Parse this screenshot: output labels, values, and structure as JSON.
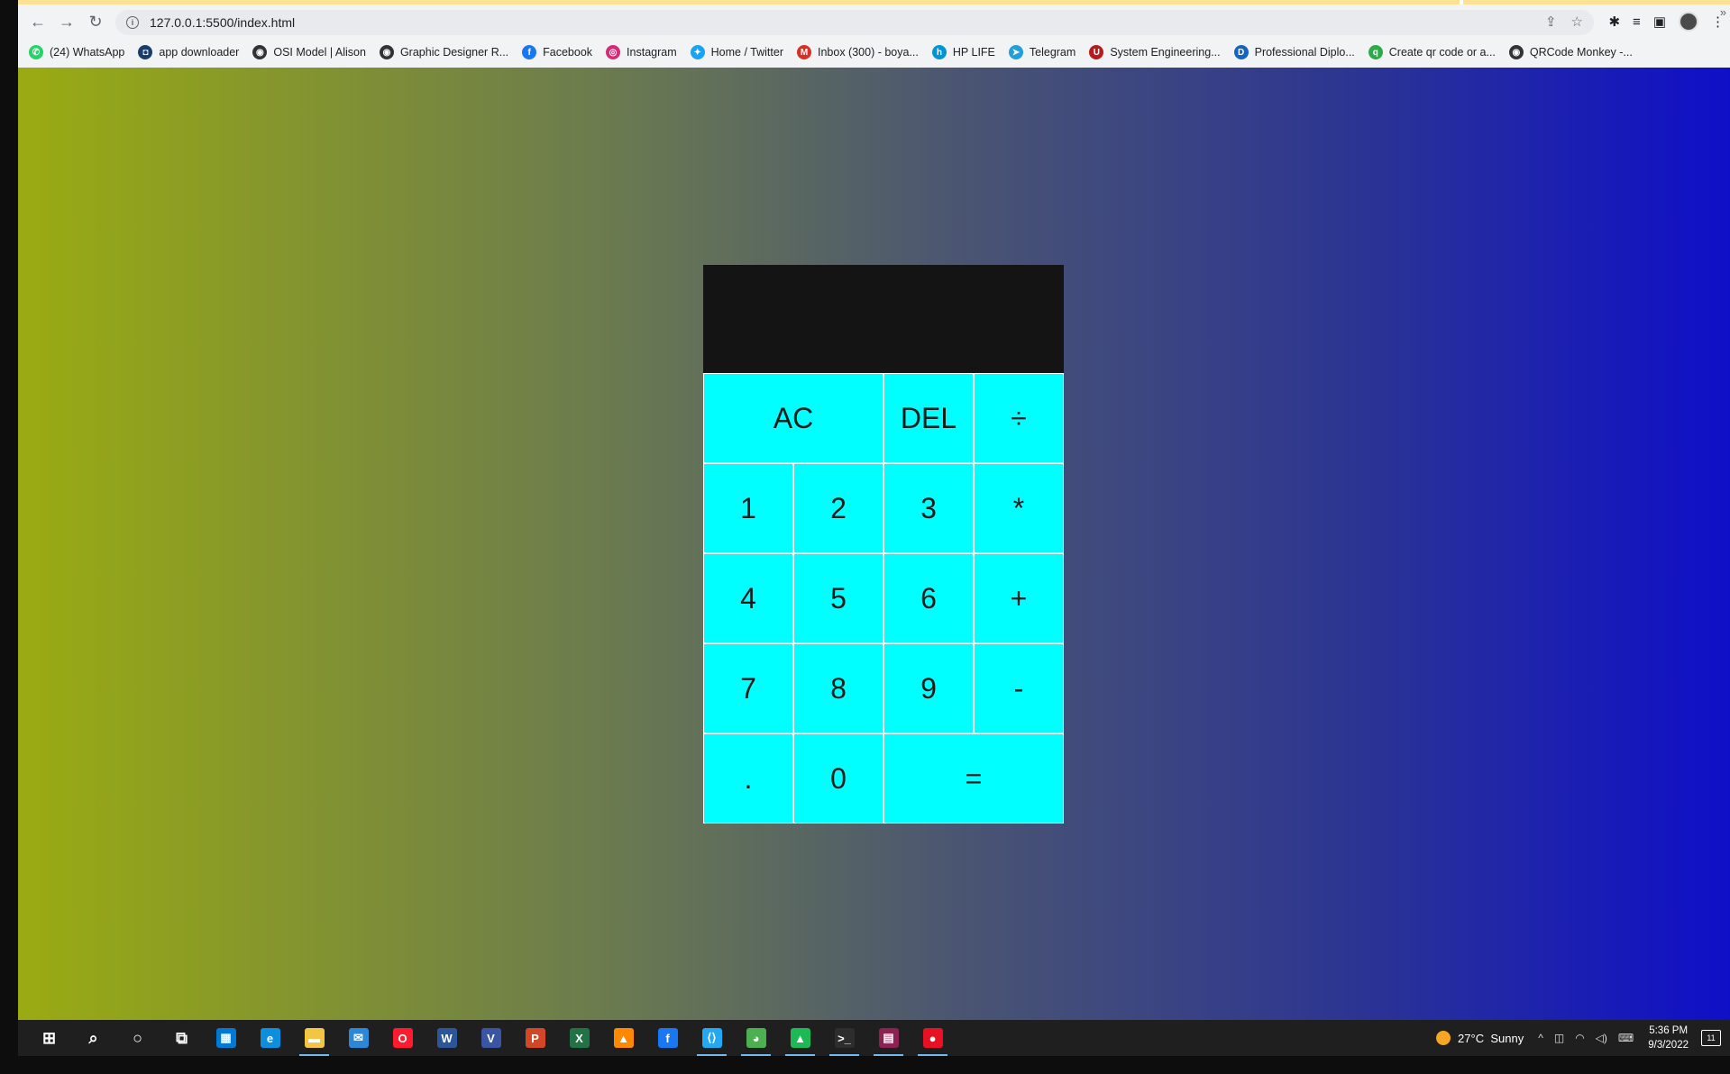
{
  "browser": {
    "url": "127.0.0.1:5500/index.html",
    "bookmarks": [
      {
        "label": "(24) WhatsApp",
        "icon": "whatsapp-icon",
        "color": "#25d366",
        "glyph": "✆"
      },
      {
        "label": "app downloader",
        "icon": "app-downloader-icon",
        "color": "#1a3d6d",
        "glyph": "◘"
      },
      {
        "label": "OSI Model | Alison",
        "icon": "globe-icon",
        "color": "#333333",
        "glyph": "◉"
      },
      {
        "label": "Graphic Designer R...",
        "icon": "globe-icon",
        "color": "#333333",
        "glyph": "◉"
      },
      {
        "label": "Facebook",
        "icon": "facebook-icon",
        "color": "#1877f2",
        "glyph": "f"
      },
      {
        "label": "Instagram",
        "icon": "instagram-icon",
        "color": "#d62976",
        "glyph": "◎"
      },
      {
        "label": "Home / Twitter",
        "icon": "twitter-icon",
        "color": "#1da1f2",
        "glyph": "✦"
      },
      {
        "label": "Inbox (300) - boya...",
        "icon": "gmail-icon",
        "color": "#d93025",
        "glyph": "M"
      },
      {
        "label": "HP LIFE",
        "icon": "hp-icon",
        "color": "#0096d6",
        "glyph": "h"
      },
      {
        "label": "Telegram",
        "icon": "telegram-icon",
        "color": "#229ed9",
        "glyph": "➤"
      },
      {
        "label": "System Engineering...",
        "icon": "university-icon",
        "color": "#b71c1c",
        "glyph": "U"
      },
      {
        "label": "Professional Diplo...",
        "icon": "document-icon",
        "color": "#1565c0",
        "glyph": "D"
      },
      {
        "label": "Create qr code or a...",
        "icon": "qr-generator-icon",
        "color": "#2eaa4a",
        "glyph": "q"
      },
      {
        "label": "QRCode Monkey -...",
        "icon": "globe-icon",
        "color": "#333333",
        "glyph": "◉"
      }
    ],
    "bookmarks_more": "»"
  },
  "calculator": {
    "previous_operand": "",
    "current_operand": "",
    "keys": {
      "ac": "AC",
      "del": "DEL",
      "divide": "÷",
      "one": "1",
      "two": "2",
      "three": "3",
      "multiply": "*",
      "four": "4",
      "five": "5",
      "six": "6",
      "add": "+",
      "seven": "7",
      "eight": "8",
      "nine": "9",
      "subtract": "-",
      "decimal": ".",
      "zero": "0",
      "equals": "="
    },
    "colors": {
      "display": "#141414",
      "key": "#00ffff"
    }
  },
  "taskbar": {
    "apps": [
      {
        "name": "start-button",
        "icon": "windows-icon",
        "color": "#ffffff",
        "glyph": "⊞"
      },
      {
        "name": "search-button",
        "icon": "search-icon",
        "color": "#ffffff",
        "glyph": "⌕"
      },
      {
        "name": "cortana-button",
        "icon": "cortana-icon",
        "color": "#ffffff",
        "glyph": "○"
      },
      {
        "name": "task-view-button",
        "icon": "task-view-icon",
        "color": "#ffffff",
        "glyph": "⧉"
      },
      {
        "name": "store-app",
        "icon": "store-icon",
        "color": "#0078d4",
        "glyph": "▦"
      },
      {
        "name": "edge-app",
        "icon": "edge-icon",
        "color": "#0c8fdc",
        "glyph": "e"
      },
      {
        "name": "file-explorer-app",
        "icon": "folder-icon",
        "color": "#f4c542",
        "glyph": "▬"
      },
      {
        "name": "mail-app",
        "icon": "mail-icon",
        "color": "#2b88d8",
        "glyph": "✉"
      },
      {
        "name": "opera-app",
        "icon": "opera-icon",
        "color": "#ff1b2d",
        "glyph": "O"
      },
      {
        "name": "word-app",
        "icon": "word-icon",
        "color": "#2b579a",
        "glyph": "W"
      },
      {
        "name": "visio-app",
        "icon": "visio-icon",
        "color": "#3955a3",
        "glyph": "V"
      },
      {
        "name": "powerpoint-app",
        "icon": "powerpoint-icon",
        "color": "#d24726",
        "glyph": "P"
      },
      {
        "name": "excel-app",
        "icon": "excel-icon",
        "color": "#217346",
        "glyph": "X"
      },
      {
        "name": "vlc-app",
        "icon": "vlc-icon",
        "color": "#ff8800",
        "glyph": "▲"
      },
      {
        "name": "facebook-app",
        "icon": "facebook-icon",
        "color": "#1877f2",
        "glyph": "f"
      },
      {
        "name": "vscode-app",
        "icon": "vscode-icon",
        "color": "#23a9f2",
        "glyph": "⟨⟩"
      },
      {
        "name": "chrome-app",
        "icon": "chrome-icon",
        "color": "#4caf50",
        "glyph": "◕"
      },
      {
        "name": "android-studio-app",
        "icon": "triangle-app-icon",
        "color": "#1db954",
        "glyph": "▲"
      },
      {
        "name": "terminal-app",
        "icon": "terminal-icon",
        "color": "#2d2d2d",
        "glyph": ">_"
      },
      {
        "name": "winrar-app",
        "icon": "winrar-icon",
        "color": "#8b2252",
        "glyph": "▤"
      },
      {
        "name": "recorder-app",
        "icon": "record-icon",
        "color": "#e81123",
        "glyph": "●"
      }
    ],
    "active_indices": [
      6,
      15,
      16,
      17,
      18,
      19,
      20
    ],
    "weather_temp": "27°C",
    "weather_text": "Sunny",
    "time": "5:36 PM",
    "date": "9/3/2022"
  }
}
